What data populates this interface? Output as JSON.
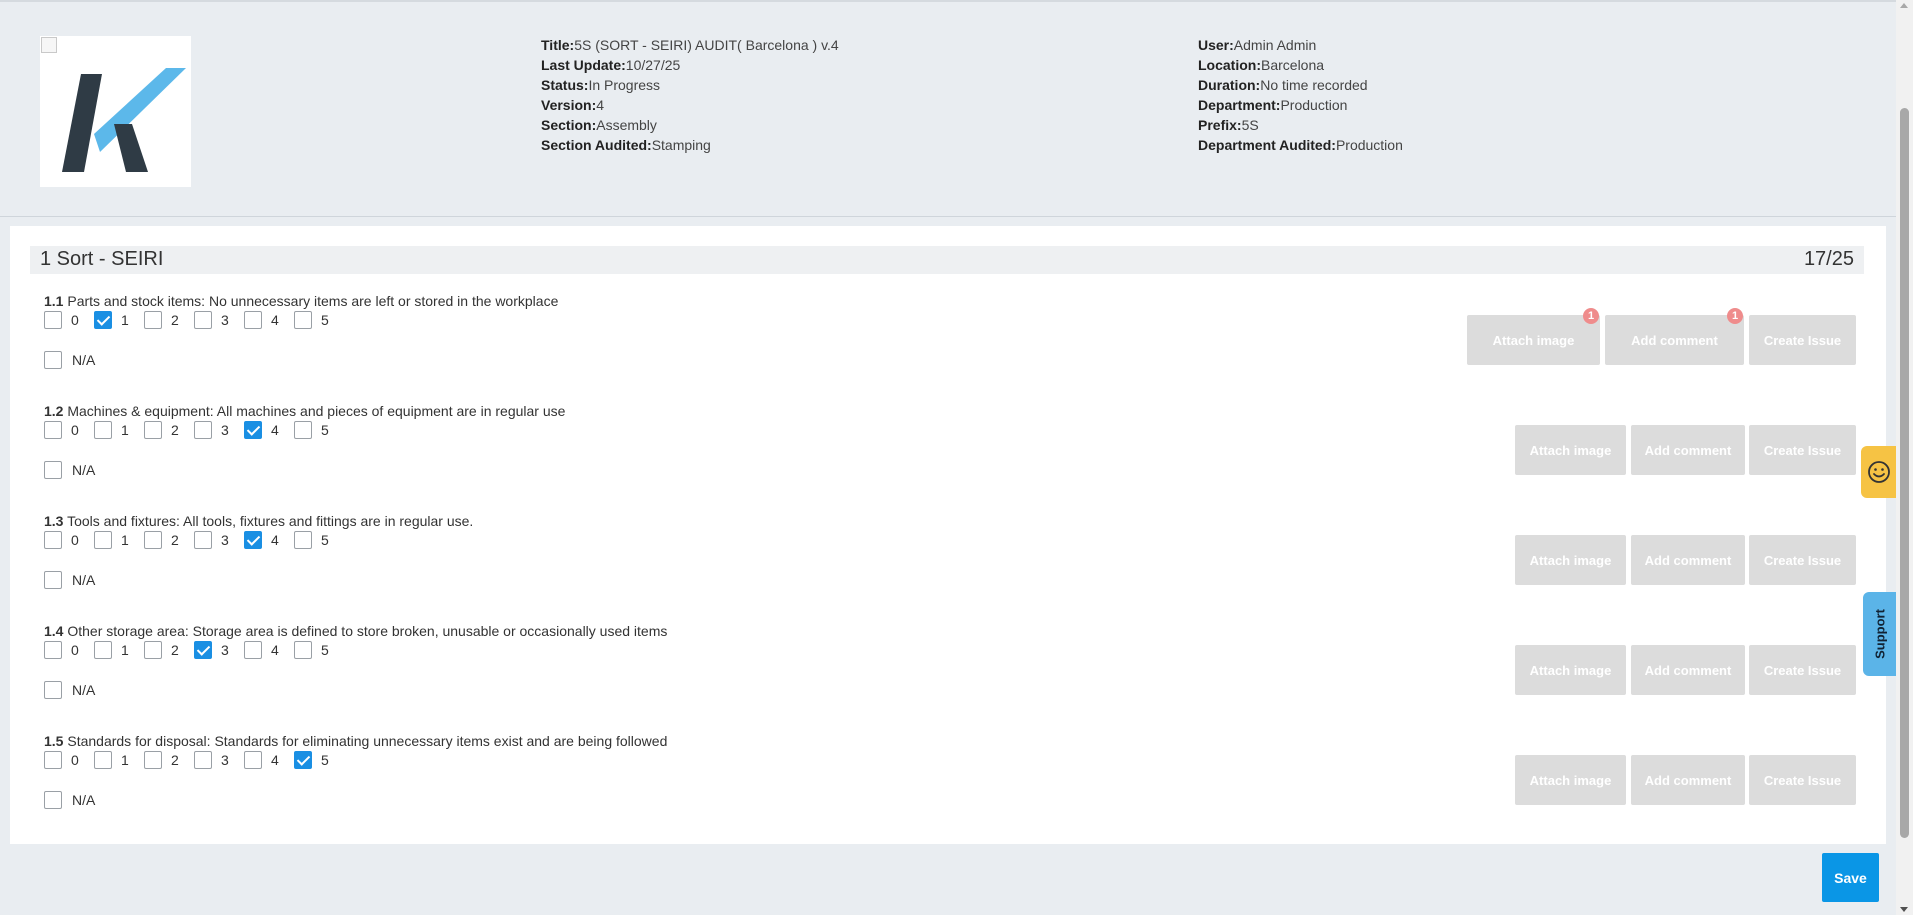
{
  "header": {
    "left": [
      {
        "label": "Title:",
        "value": "5S (SORT - SEIRI) AUDIT( Barcelona ) v.4"
      },
      {
        "label": "Last Update:",
        "value": "10/27/25"
      },
      {
        "label": "Status:",
        "value": "In Progress"
      },
      {
        "label": "Version:",
        "value": "4"
      },
      {
        "label": "Section:",
        "value": "Assembly"
      },
      {
        "label": "Section Audited:",
        "value": "Stamping"
      }
    ],
    "right": [
      {
        "label": "User:",
        "value": "Admin Admin"
      },
      {
        "label": "Location:",
        "value": "Barcelona"
      },
      {
        "label": "Duration:",
        "value": "No time recorded"
      },
      {
        "label": "Department:",
        "value": "Production"
      },
      {
        "label": "Prefix:",
        "value": "5S"
      },
      {
        "label": "Department Audited:",
        "value": "Production"
      }
    ]
  },
  "section": {
    "title": "1 Sort - SEIRI",
    "score": "17/25"
  },
  "options": [
    "0",
    "1",
    "2",
    "3",
    "4",
    "5"
  ],
  "na_label": "N/A",
  "buttons": {
    "attach": "Attach image",
    "comment": "Add comment",
    "issue": "Create Issue"
  },
  "questions": [
    {
      "number": "1.1",
      "text": "Parts and stock items: No unnecessary items are left or stored in the workplace",
      "selected": 1,
      "attach_badge": "1",
      "comment_badge": "1"
    },
    {
      "number": "1.2",
      "text": "Machines & equipment: All machines and pieces of equipment are in regular use",
      "selected": 4
    },
    {
      "number": "1.3",
      "text": "Tools and fixtures: All tools, fixtures and fittings are in regular use.",
      "selected": 4
    },
    {
      "number": "1.4",
      "text": "Other storage area: Storage area is defined to store broken, unusable or occasionally used items",
      "selected": 3
    },
    {
      "number": "1.5",
      "text": "Standards for disposal: Standards for eliminating unnecessary items exist and are being followed",
      "selected": 5
    }
  ],
  "save_label": "Save",
  "support_label": "Support",
  "colors": {
    "accent": "#1a8fe3",
    "save": "#0a96e6",
    "badge": "#ef8c8c",
    "smiley": "#f6c344",
    "support": "#5bb4e8"
  }
}
